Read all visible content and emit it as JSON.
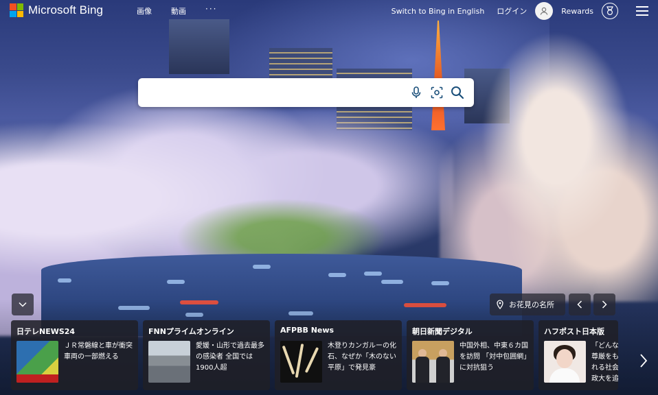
{
  "header": {
    "logo_text": "Microsoft Bing",
    "nav": [
      {
        "label": "画像"
      },
      {
        "label": "動画"
      },
      {
        "label": "···"
      }
    ],
    "switch_label": "Switch to Bing in English",
    "login_label": "ログイン",
    "rewards_label": "Rewards"
  },
  "search": {
    "value": "",
    "placeholder": ""
  },
  "icons": {
    "mic": "microphone-icon",
    "visual_search": "camera-search-icon",
    "search": "search-icon",
    "collapse": "chevron-down-icon",
    "location": "location-pin-icon",
    "prev": "chevron-left-icon",
    "next": "chevron-right-icon",
    "menu": "hamburger-menu-icon",
    "avatar": "user-avatar-icon",
    "rewards": "rewards-badge-icon"
  },
  "image_info": {
    "label": "お花見の名所"
  },
  "news": [
    {
      "source": "日テレNEWS24",
      "title": "ＪＲ常磐線と車が衝突 車両の一部燃える"
    },
    {
      "source": "FNNプライムオンライン",
      "title": "愛媛・山形で過去最多の感染者 全国では1900人超"
    },
    {
      "source": "AFPBB News",
      "title": "木登りカンガルーの化石、なぜか「木のない平原」で発見豪"
    },
    {
      "source": "朝日新聞デジタル",
      "title": "中国外相、中東６カ国を訪問 「対中包囲網」に対抗狙う"
    },
    {
      "source": "ハフポスト日本版",
      "title": "「どんな尊厳をもれる社会政大を追"
    }
  ],
  "colors": {
    "search_bg": "#ffffff",
    "card_bg": "#202026",
    "logo_red": "#f25022",
    "logo_green": "#7fba00",
    "logo_blue": "#00a4ef",
    "logo_yellow": "#ffb900"
  }
}
